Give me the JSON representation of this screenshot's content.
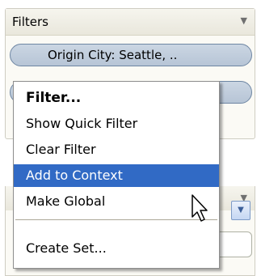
{
  "filters_panel": {
    "title": "Filters",
    "filter_pill_label": "Origin City: Seattle, ..",
    "collapse_icon": "triangle-down-icon"
  },
  "second_panel": {
    "collapse_icon": "triangle-down-icon",
    "dropdown_icon": "chevron-down-icon"
  },
  "context_menu": {
    "items": [
      {
        "label": "Filter...",
        "bold": true
      },
      {
        "label": "Show Quick Filter"
      },
      {
        "label": "Clear Filter"
      },
      {
        "label": "Add to Context",
        "selected": true
      },
      {
        "label": "Make Global"
      },
      {
        "label": "Create Set..."
      }
    ]
  },
  "colors": {
    "highlight": "#316ac5",
    "pill_fill": "#b7c5d6",
    "pill_border": "#6e86a3"
  }
}
